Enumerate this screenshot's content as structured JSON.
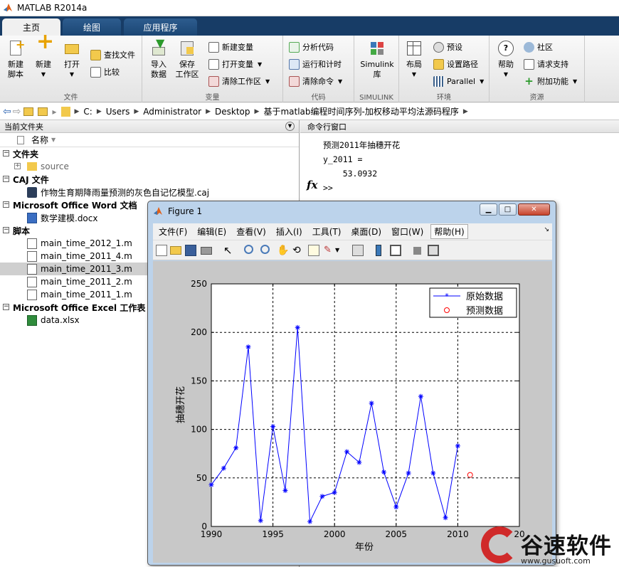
{
  "window": {
    "title": "MATLAB R2014a"
  },
  "tabs": [
    "主页",
    "绘图",
    "应用程序"
  ],
  "ribbon": {
    "file": {
      "new_script": "新建\n脚本",
      "new": "新建",
      "open": "打开",
      "find_files": "查找文件",
      "compare": "比较",
      "label": "文件"
    },
    "variable": {
      "import": "导入\n数据",
      "save_ws": "保存\n工作区",
      "new_var": "新建变量",
      "open_var": "打开变量",
      "clear_ws": "清除工作区",
      "label": "变量"
    },
    "code": {
      "analyze": "分析代码",
      "run_time": "运行和计时",
      "clear_cmd": "清除命令",
      "label": "代码"
    },
    "simulink": {
      "btn": "Simulink\n库",
      "label": "SIMULINK"
    },
    "env": {
      "layout": "布局",
      "prefs": "预设",
      "set_path": "设置路径",
      "parallel": "Parallel",
      "label": "环境"
    },
    "resources": {
      "help": "帮助",
      "community": "社区",
      "support": "请求支持",
      "addons": "附加功能",
      "label": "资源"
    }
  },
  "path": [
    "C:",
    "Users",
    "Administrator",
    "Desktop",
    "基于matlab编程时间序列-加权移动平均法源码程序"
  ],
  "left_panel": {
    "title": "当前文件夹",
    "col_name": "名称",
    "groups": [
      {
        "name": "文件夹",
        "items": [
          "source"
        ]
      },
      {
        "name": "CAJ 文件",
        "items": [
          "作物生育期降雨量预测的灰色自记忆模型.caj"
        ]
      },
      {
        "name": "Microsoft Office Word 文档",
        "items": [
          "数学建模.docx"
        ]
      },
      {
        "name": "脚本",
        "items": [
          "main_time_2012_1.m",
          "main_time_2011_4.m",
          "main_time_2011_3.m",
          "main_time_2011_2.m",
          "main_time_2011_1.m"
        ]
      },
      {
        "name": "Microsoft Office Excel 工作表",
        "items": [
          "data.xlsx"
        ]
      }
    ]
  },
  "command_window": {
    "title": "命令行窗口",
    "lines": [
      "预测2011年抽穗开花",
      "y_2011 =",
      "    53.0932"
    ],
    "prompt": ">>",
    "fx": "fx"
  },
  "figure": {
    "title": "Figure 1",
    "menu": [
      "文件(F)",
      "编辑(E)",
      "查看(V)",
      "插入(I)",
      "工具(T)",
      "桌面(D)",
      "窗口(W)",
      "帮助(H)"
    ]
  },
  "chart_data": {
    "type": "line",
    "xlabel": "年份",
    "ylabel": "抽穗开花",
    "xlim": [
      1990,
      2015
    ],
    "ylim": [
      0,
      250
    ],
    "xticks": [
      1990,
      1995,
      2000,
      2005,
      2010,
      2015
    ],
    "yticks": [
      0,
      50,
      100,
      150,
      200,
      250
    ],
    "xtick_labels": [
      "1990",
      "1995",
      "2000",
      "2005",
      "2010",
      "20"
    ],
    "ytick_labels": [
      "0",
      "50",
      "100",
      "150",
      "200",
      "250"
    ],
    "grid": true,
    "legend_position": "top-right",
    "series": [
      {
        "name": "原始数据",
        "color": "#0000ff",
        "marker": "*",
        "x": [
          1990,
          1991,
          1992,
          1993,
          1994,
          1995,
          1996,
          1997,
          1998,
          1999,
          2000,
          2001,
          2002,
          2003,
          2004,
          2005,
          2006,
          2007,
          2008,
          2009,
          2010
        ],
        "y": [
          43,
          60,
          81,
          185,
          6,
          103,
          37,
          205,
          5,
          31,
          35,
          77,
          66,
          127,
          56,
          20,
          55,
          134,
          55,
          9,
          83
        ]
      },
      {
        "name": "预测数据",
        "color": "#ff0000",
        "marker": "o",
        "x": [
          2011
        ],
        "y": [
          53.0932
        ]
      }
    ]
  },
  "watermark": {
    "brand": "谷速软件",
    "url": "www.gusuoft.com"
  }
}
